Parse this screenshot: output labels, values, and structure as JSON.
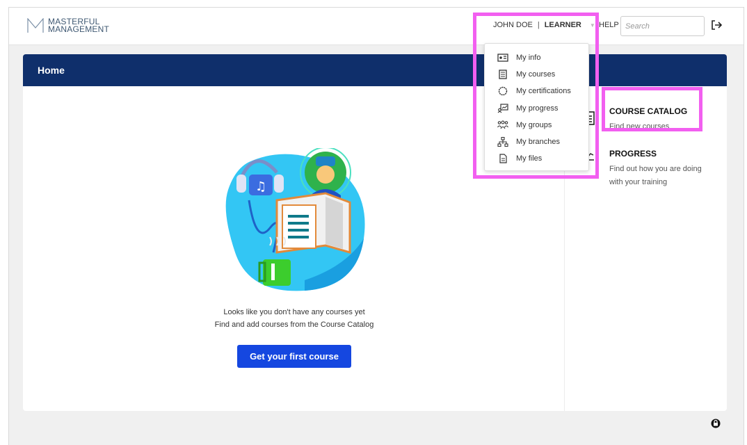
{
  "brand": {
    "line1": "MASTERFUL",
    "line2": "MANAGEMENT"
  },
  "header": {
    "user_name": "JOHN DOE",
    "separator": "|",
    "role": "LEARNER",
    "help_label": "HELP",
    "search_placeholder": "Search"
  },
  "user_menu": {
    "items": [
      {
        "label": "My info",
        "icon": "id-card-icon"
      },
      {
        "label": "My courses",
        "icon": "book-icon"
      },
      {
        "label": "My certifications",
        "icon": "certificate-icon"
      },
      {
        "label": "My progress",
        "icon": "progress-chart-icon"
      },
      {
        "label": "My groups",
        "icon": "group-icon"
      },
      {
        "label": "My branches",
        "icon": "branches-icon"
      },
      {
        "label": "My files",
        "icon": "file-icon"
      }
    ]
  },
  "main": {
    "title": "Home",
    "empty_line1": "Looks like you don't have any courses yet",
    "empty_line2": "Find and add courses from the Course Catalog",
    "cta_label": "Get your first course"
  },
  "sidebar": {
    "catalog_title": "COURSE CATALOG",
    "catalog_desc": "Find new courses",
    "progress_title": "PROGRESS",
    "progress_desc": "Find out how you are doing with your training"
  },
  "colors": {
    "header_bg": "#0f2f6b",
    "button_bg": "#1547e0",
    "highlight": "#f25ff0"
  }
}
